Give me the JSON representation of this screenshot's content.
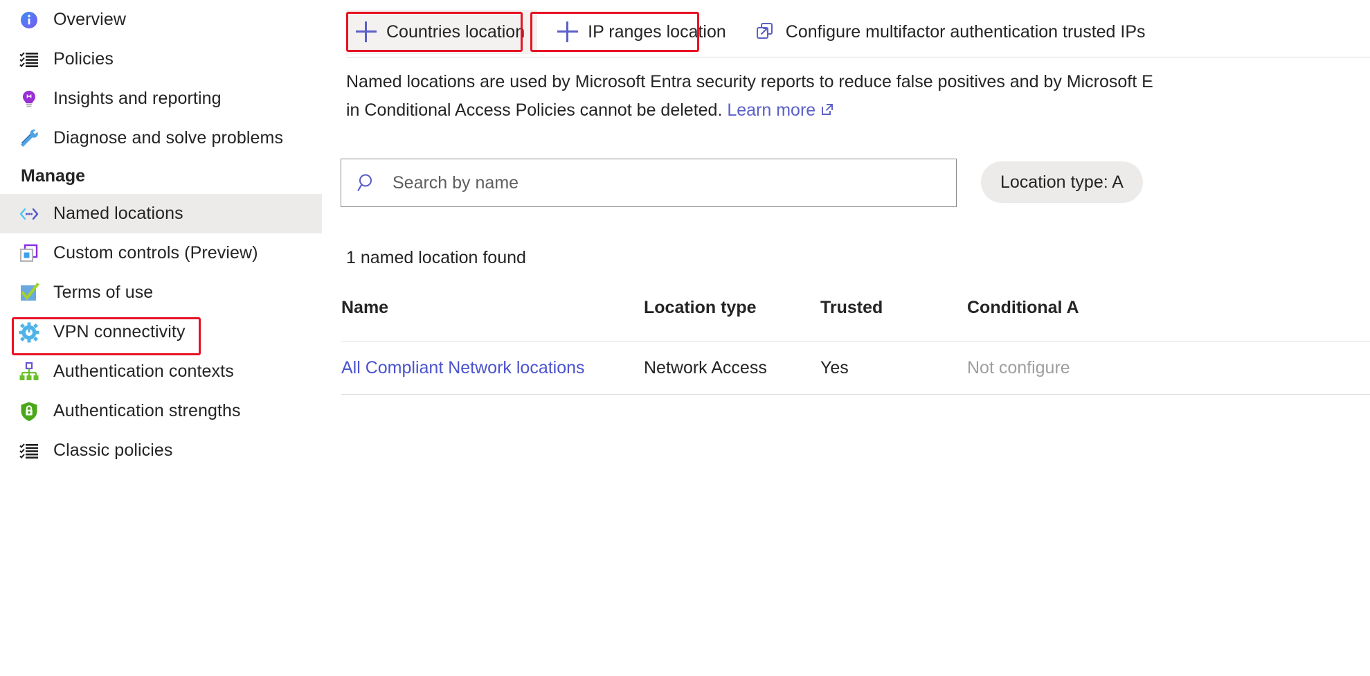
{
  "sidebar": {
    "items": [
      {
        "label": "Overview",
        "icon": "info-icon"
      },
      {
        "label": "Policies",
        "icon": "checklist-icon"
      },
      {
        "label": "Insights and reporting",
        "icon": "lightbulb-icon"
      },
      {
        "label": "Diagnose and solve problems",
        "icon": "wrench-screwdriver-icon"
      }
    ],
    "section_label": "Manage",
    "manage_items": [
      {
        "label": "Named locations",
        "icon": "named-locations-icon",
        "selected": true
      },
      {
        "label": "Custom controls (Preview)",
        "icon": "custom-controls-icon",
        "selected": false
      },
      {
        "label": "Terms of use",
        "icon": "terms-of-use-icon",
        "selected": false
      },
      {
        "label": "VPN connectivity",
        "icon": "vpn-gear-icon",
        "selected": false
      },
      {
        "label": "Authentication contexts",
        "icon": "hierarchy-icon",
        "selected": false
      },
      {
        "label": "Authentication strengths",
        "icon": "shield-lock-icon",
        "selected": false
      },
      {
        "label": "Classic policies",
        "icon": "checklist-icon",
        "selected": false
      }
    ]
  },
  "main": {
    "collapse_glyph": "«",
    "toolbar": [
      {
        "label": "Countries location",
        "icon": "plus-icon",
        "hovered": true,
        "highlighted": true
      },
      {
        "label": "IP ranges location",
        "icon": "plus-icon",
        "hovered": false,
        "highlighted": true
      },
      {
        "label": "Configure multifactor authentication trusted IPs",
        "icon": "external-link-icon",
        "hovered": false,
        "highlighted": false
      }
    ],
    "description_line1": "Named locations are used by Microsoft Entra security reports to reduce false positives and by Microsoft E",
    "description_line2_pre": "in Conditional Access Policies cannot be deleted. ",
    "learn_more_label": "Learn more",
    "search": {
      "placeholder": "Search by name",
      "value": ""
    },
    "filter_pill_label": "Location type: A",
    "count_text": "1 named location found",
    "table": {
      "columns": [
        "Name",
        "Location type",
        "Trusted",
        "Conditional A"
      ],
      "rows": [
        {
          "name": "All Compliant Network locations",
          "location_type": "Network Access",
          "trusted": "Yes",
          "conditional_access": "Not configure"
        }
      ]
    }
  },
  "colors": {
    "accent": "#5b5fc7",
    "link": "#4b53cf",
    "annotation": "#e81123",
    "selected_row": "#EDEBE9",
    "muted_text": "#a19f9d"
  }
}
